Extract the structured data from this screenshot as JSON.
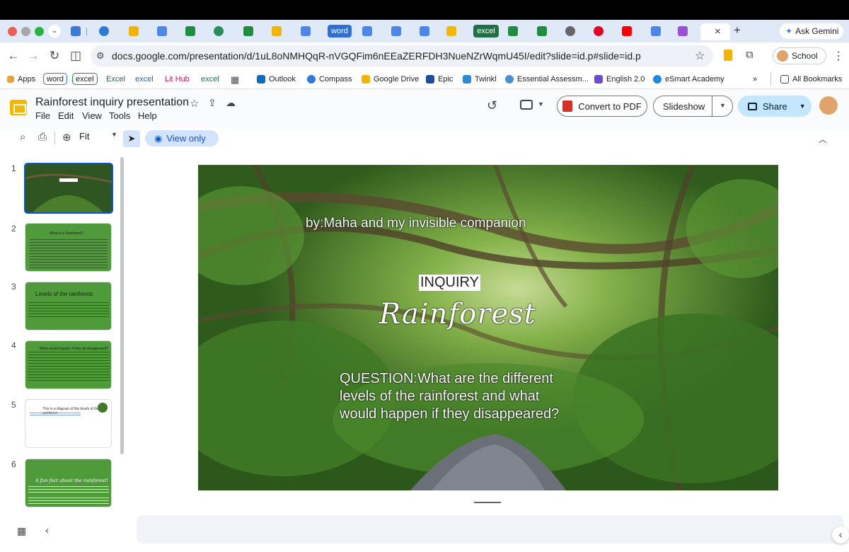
{
  "browser": {
    "tabs": {
      "word": "word",
      "excel": "excel",
      "close_icon": "×",
      "new_tab": "+",
      "ask_gemini": "Ask Gemini"
    },
    "url": "docs.google.com/presentation/d/1uL8oNMHQqR-nVGQFim6nEEaZERFDH3NueNZrWqmU45I/edit?slide=id.p#slide=id.p",
    "profile_label": "School",
    "bookmarks": {
      "apps": "Apps",
      "word": "word",
      "excel_boxed": "excel",
      "excel_cap": "Excel",
      "excel_lower": "excel",
      "lit_hub": "Lit Hub",
      "excel_last": "excel",
      "outlook": "Outlook",
      "compass": "Compass",
      "google_drive": "Google Drive",
      "epic": "Epic",
      "twinkl": "Twinkl",
      "essential": "Essential Assessm...",
      "english": "English 2.0",
      "esmart": "eSmart Academy",
      "more": "»",
      "all_bookmarks": "All Bookmarks"
    }
  },
  "app": {
    "doc_title": "Rainforest inquiry presentation",
    "menu": [
      "File",
      "Edit",
      "View",
      "Tools",
      "Help"
    ],
    "convert_pdf": "Convert to PDF",
    "slideshow": "Slideshow",
    "share": "Share",
    "zoom": "Fit",
    "view_only": "View only"
  },
  "filmstrip": {
    "numbers": [
      "1",
      "2",
      "3",
      "4",
      "5",
      "6"
    ],
    "slide2_title": "What is a Rainforest?",
    "slide3_title": "Levels of the rainforest",
    "slide4_title": "What would happen if they all disappeared?",
    "slide5_title": "This is a diagram of the levels of the rainforest",
    "slide6_title": "A fun fact about the rainforest!"
  },
  "slide": {
    "byline": "by:Maha and my invisible companion",
    "inquiry": "INQUIRY",
    "title": "Rainforest",
    "question": "QUESTION:What are the different levels of the rainforest and what would happen if they disappeared?"
  },
  "colors": {
    "accent": "#0b57d0",
    "share_bg": "#c2e7ff",
    "thumb_green": "#4f9a3a",
    "pdf_red": "#d93025"
  }
}
